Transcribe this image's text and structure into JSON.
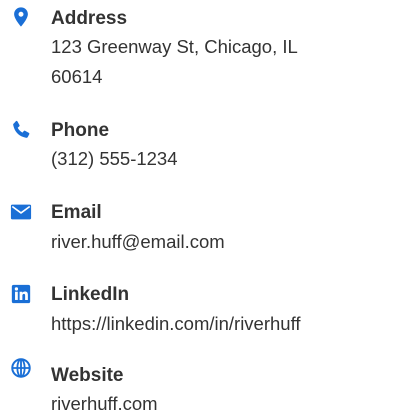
{
  "accent_color": "#1a6fd6",
  "contact": {
    "address": {
      "icon": "map-marker-icon",
      "label": "Address",
      "value_line1": "123 Greenway St, Chicago, IL",
      "value_line2": "60614"
    },
    "phone": {
      "icon": "phone-icon",
      "label": "Phone",
      "value": "(312) 555-1234"
    },
    "email": {
      "icon": "envelope-icon",
      "label": "Email",
      "value": "river.huff@email.com"
    },
    "linkedin": {
      "icon": "linkedin-icon",
      "label": "LinkedIn",
      "value": "https://linkedin.com/in/riverhuff"
    },
    "website": {
      "icon": "globe-icon",
      "label": "Website",
      "value": "riverhuff.com"
    }
  }
}
